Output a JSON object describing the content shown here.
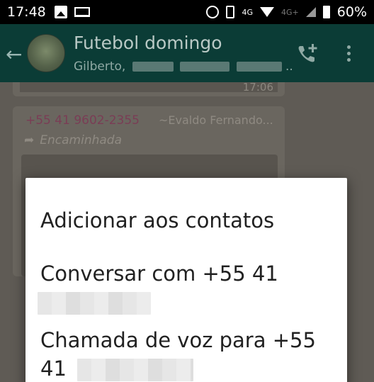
{
  "status_bar": {
    "time": "17:48",
    "network_labels": [
      "4G",
      "4G+"
    ],
    "battery": "60%",
    "icons": [
      "photo-icon",
      "laptop-icon",
      "alarm-icon",
      "vibrate-icon",
      "phone-4g-icon",
      "wifi-icon",
      "signal-icon",
      "battery-icon"
    ]
  },
  "app_bar": {
    "title": "Futebol domingo",
    "subtitle": "Gilberto,",
    "subtitle_suffix": "..",
    "icons": [
      "back-arrow-icon",
      "add-call-icon",
      "more-vert-icon"
    ]
  },
  "chat": {
    "prev_time": "17:06",
    "message": {
      "sender_phone": "+55 41 9602-2355",
      "sender_name": "~Evaldo Fernando...",
      "forwarded_label": "Encaminhada"
    }
  },
  "dialog": {
    "items": [
      {
        "label": "Adicionar aos contatos"
      },
      {
        "label": "Conversar com +55 41"
      },
      {
        "label": "Chamada de voz para +55",
        "label_line2": "41"
      }
    ]
  },
  "colors": {
    "app_bar": "#0b3c36",
    "dialog_bg": "#ffffff",
    "dialog_text": "#212121",
    "sender_phone": "#7a3d55"
  }
}
